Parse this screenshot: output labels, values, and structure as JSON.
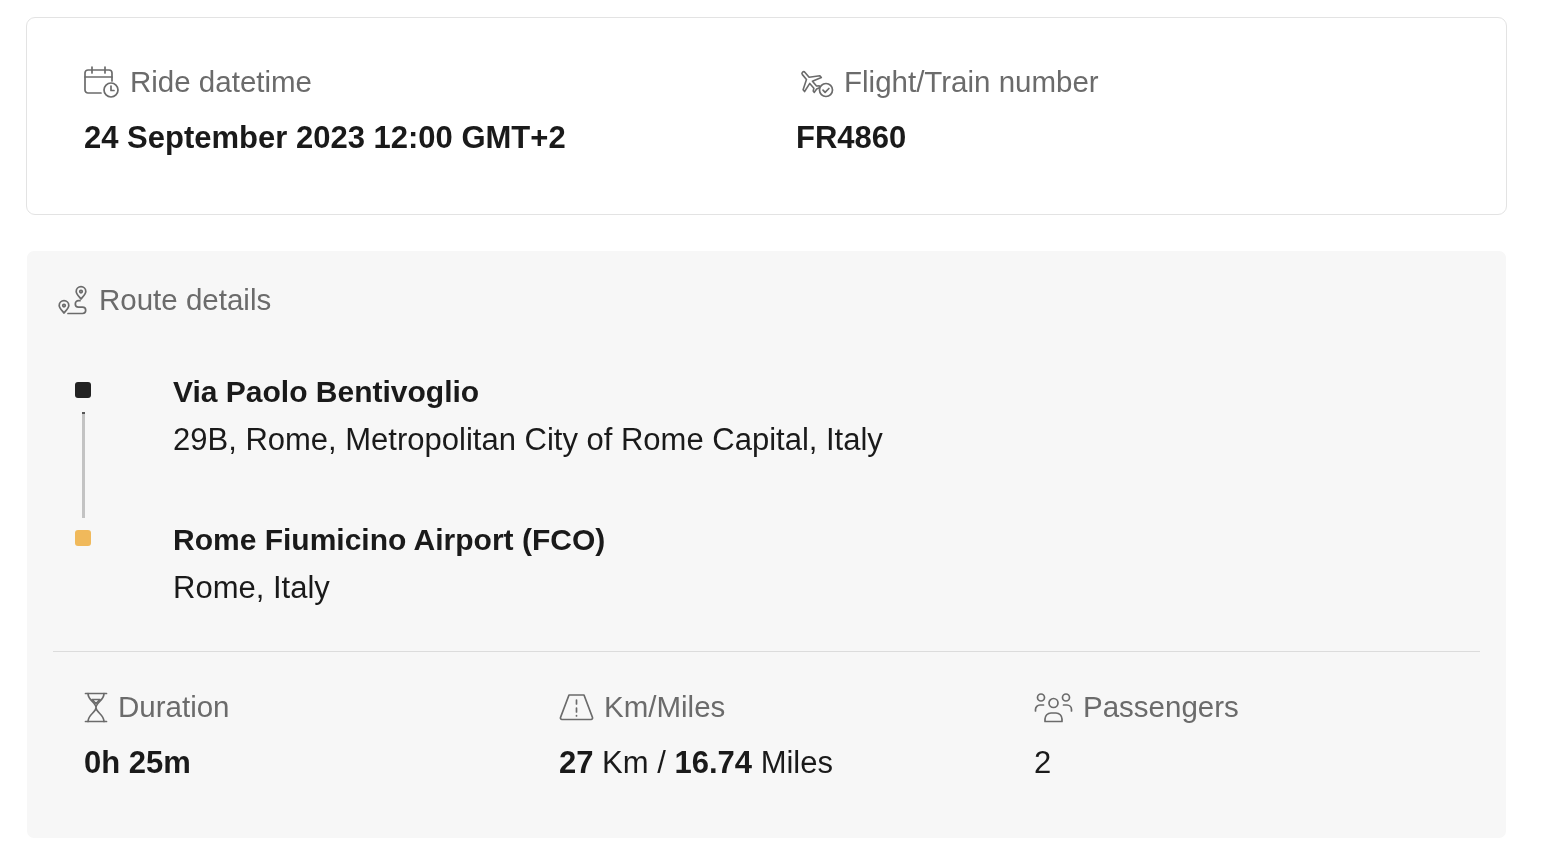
{
  "trip_info": {
    "fields": [
      {
        "label": "Ride datetime",
        "value": "24 September 2023 12:00 GMT+2"
      },
      {
        "label": "Flight/Train number",
        "value": "FR4860"
      }
    ]
  },
  "route_details": {
    "title": "Route details",
    "stops": [
      {
        "name": "Via Paolo Bentivoglio",
        "address": "29B, Rome, Metropolitan City of Rome Capital, Italy",
        "color": "#222222"
      },
      {
        "name": "Rome Fiumicino Airport (FCO)",
        "address": "Rome, Italy",
        "color": "#f0b95b"
      }
    ],
    "stats": [
      {
        "label": "Duration",
        "value": "0h 25m",
        "bold": true
      },
      {
        "label": "Km/Miles",
        "value": "**27** Km / **16.74** Miles",
        "bold": false
      },
      {
        "label": "Passengers",
        "value": "2",
        "bold": false
      }
    ]
  }
}
